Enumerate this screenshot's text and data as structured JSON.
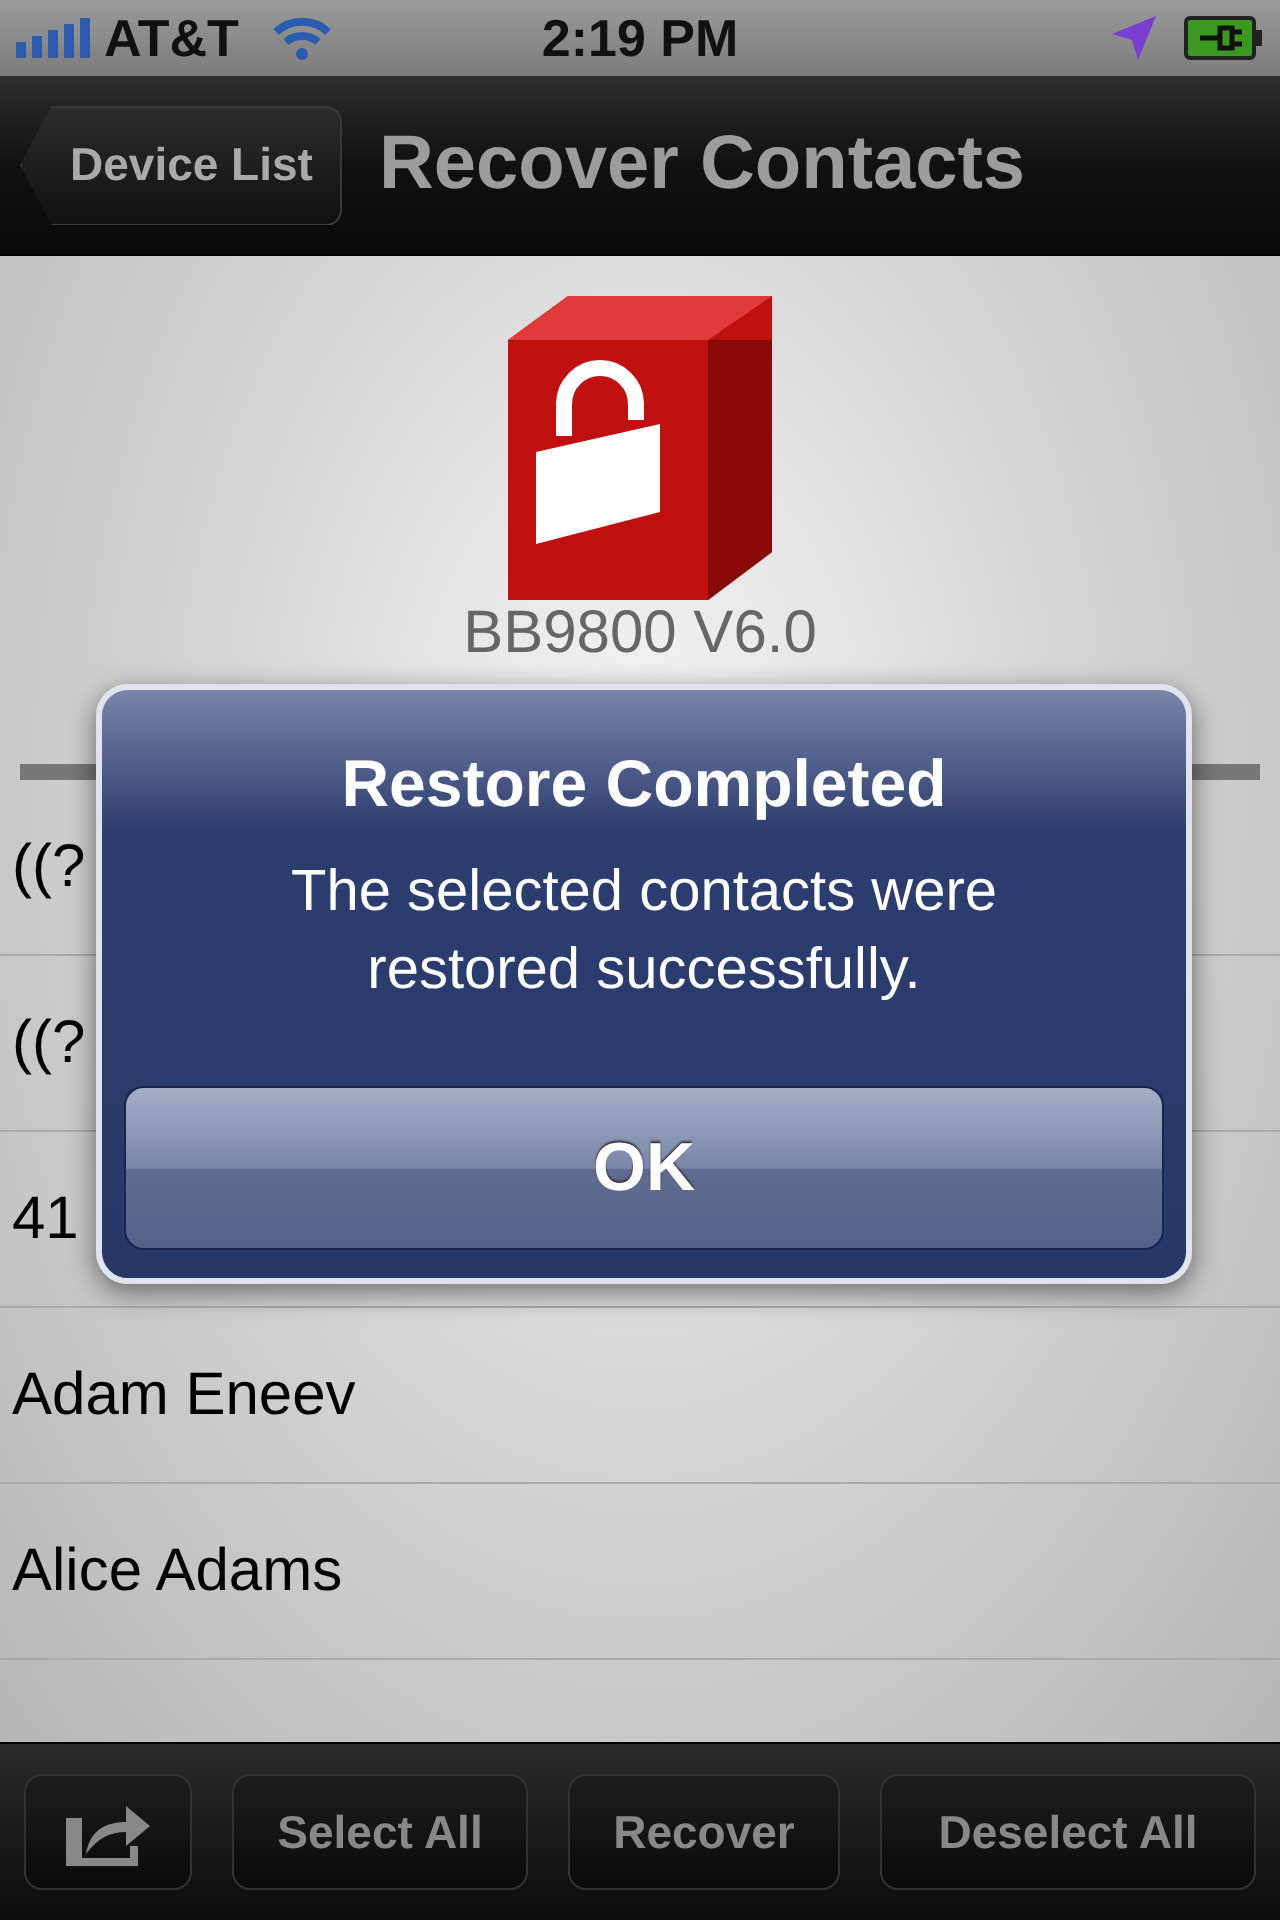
{
  "status_bar": {
    "carrier": "AT&T",
    "time": "2:19 PM"
  },
  "nav_bar": {
    "back_button": "Device List",
    "title": "Recover Contacts"
  },
  "device": {
    "name": "BB9800 V6.0"
  },
  "contacts": [
    {
      "name": "((?"
    },
    {
      "name": "((?"
    },
    {
      "name": "41"
    },
    {
      "name": "Adam Eneev"
    },
    {
      "name": "Alice Adams"
    }
  ],
  "alert": {
    "title": "Restore Completed",
    "message": "The selected contacts were restored successfully.",
    "button": "OK"
  },
  "toolbar": {
    "buttons": [
      "Select All",
      "Recover",
      "Deselect All"
    ]
  }
}
